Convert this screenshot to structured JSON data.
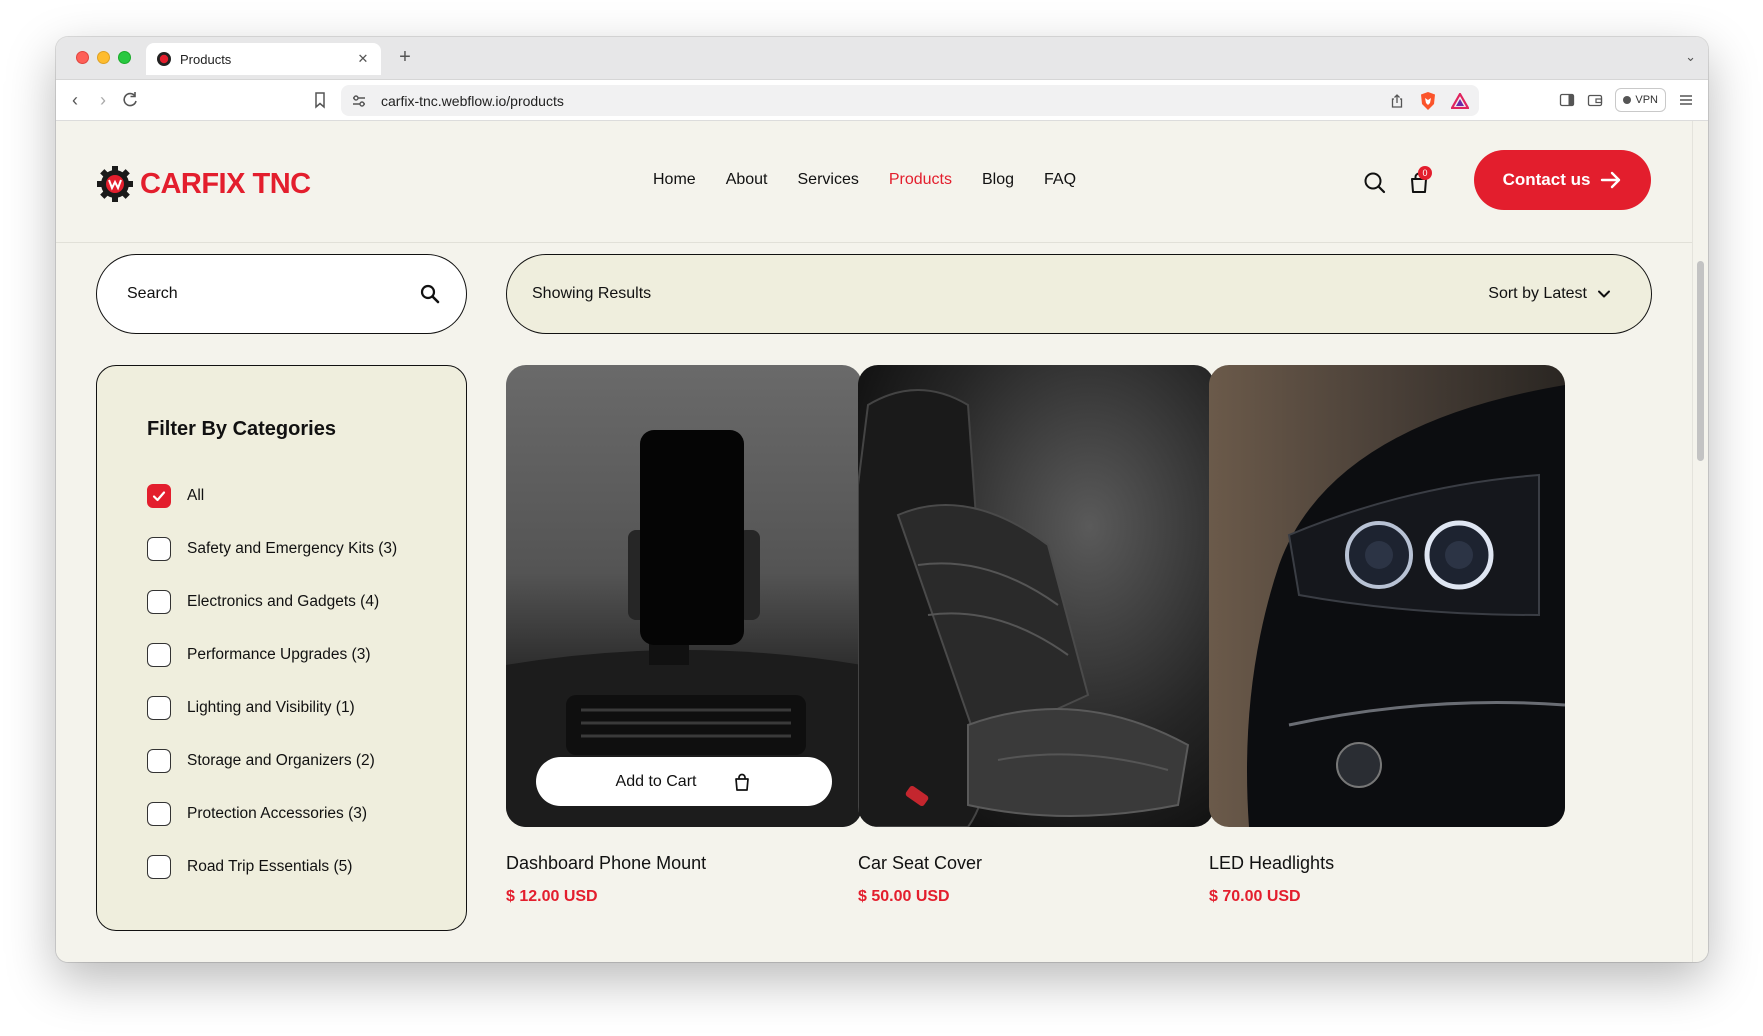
{
  "browser": {
    "tab_title": "Products",
    "url": "carfix-tnc.webflow.io/products",
    "vpn_label": "VPN"
  },
  "header": {
    "logo_text": "CARFIX TNC",
    "nav": [
      "Home",
      "About",
      "Services",
      "Products",
      "Blog",
      "FAQ"
    ],
    "active_nav": "Products",
    "cart_count": "0",
    "contact_label": "Contact us"
  },
  "search": {
    "placeholder": "Search"
  },
  "results": {
    "label": "Showing Results",
    "sort_label": "Sort by Latest"
  },
  "filter": {
    "title": "Filter By Categories",
    "categories": [
      {
        "label": "All",
        "checked": true
      },
      {
        "label": "Safety and Emergency Kits (3)",
        "checked": false
      },
      {
        "label": "Electronics and Gadgets (4)",
        "checked": false
      },
      {
        "label": "Performance Upgrades (3)",
        "checked": false
      },
      {
        "label": "Lighting and Visibility (1)",
        "checked": false
      },
      {
        "label": "Storage and Organizers (2)",
        "checked": false
      },
      {
        "label": "Protection Accessories (3)",
        "checked": false
      },
      {
        "label": "Road Trip Essentials (5)",
        "checked": false
      }
    ]
  },
  "products": [
    {
      "name": "Dashboard Phone Mount",
      "price": "$ 12.00 USD",
      "add_to_cart": "Add to Cart"
    },
    {
      "name": "Car Seat Cover",
      "price": "$ 50.00 USD"
    },
    {
      "name": "LED Headlights",
      "price": "$ 70.00 USD"
    }
  ],
  "colors": {
    "accent": "#e31e2d",
    "page_bg": "#f4f3ec",
    "panel_bg": "#efeedd"
  }
}
